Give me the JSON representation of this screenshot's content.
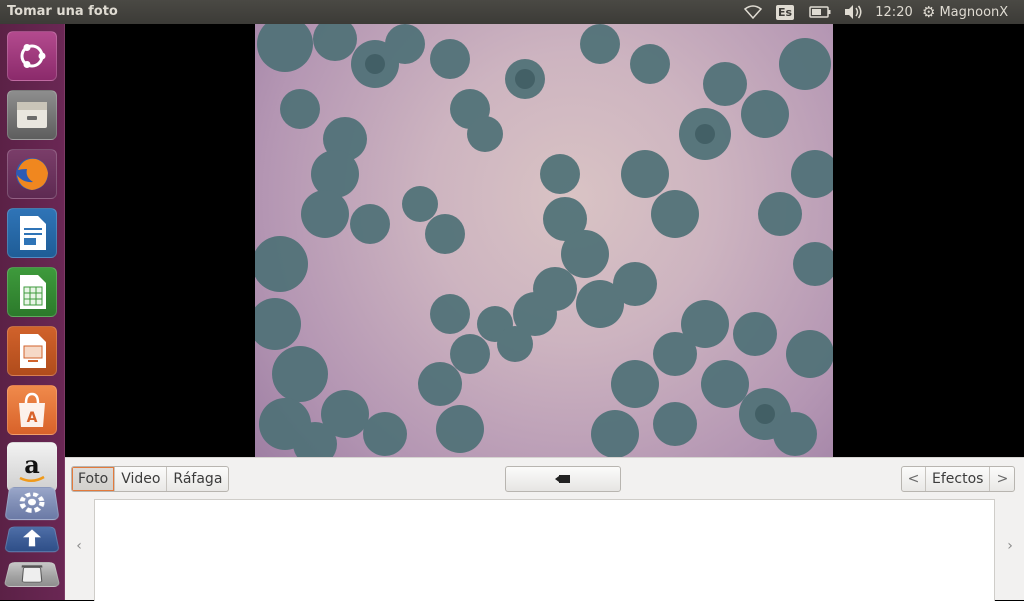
{
  "window": {
    "title": "Tomar una foto"
  },
  "panel": {
    "keyboard_layout": "Es",
    "clock": "12:20",
    "user": "MagnoonX"
  },
  "launcher": {
    "items": [
      {
        "name": "ubuntu-dash-icon"
      },
      {
        "name": "files-icon"
      },
      {
        "name": "firefox-icon"
      },
      {
        "name": "libreoffice-writer-icon"
      },
      {
        "name": "libreoffice-calc-icon"
      },
      {
        "name": "libreoffice-impress-icon"
      },
      {
        "name": "ubuntu-software-icon"
      },
      {
        "name": "amazon-icon"
      },
      {
        "name": "system-settings-icon"
      },
      {
        "name": "updater-icon"
      },
      {
        "name": "trash-icon"
      }
    ]
  },
  "modes": {
    "photo": "Foto",
    "video": "Video",
    "burst": "Ráfaga",
    "selected": "Foto"
  },
  "effects": {
    "label": "Efectos",
    "prev": "<",
    "next": ">"
  },
  "gallery": {
    "scroll_left": "‹",
    "scroll_right": "›"
  },
  "colors": {
    "launcher": "#5b2146",
    "panel": "#3c3b37",
    "accent": "#e37a3c"
  }
}
